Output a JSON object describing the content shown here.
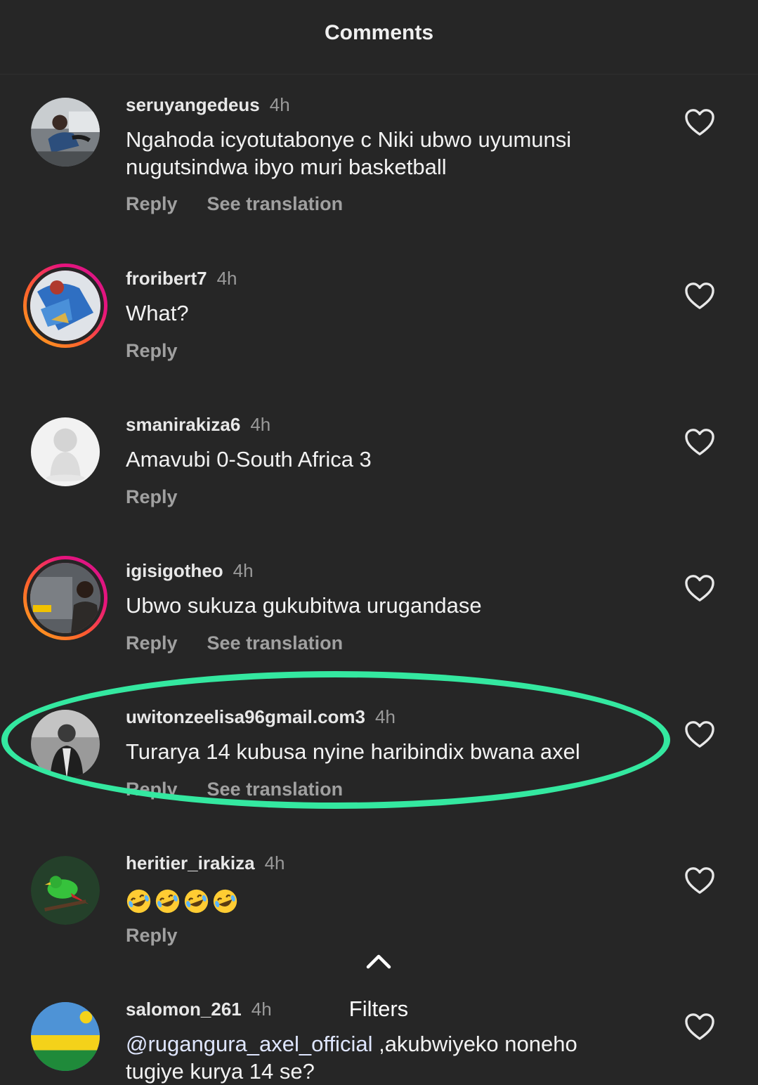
{
  "header": {
    "title": "Comments"
  },
  "comments": [
    {
      "username": "seruyangedeus",
      "time": "4h",
      "text": "Ngahoda icyotutabonye c Niki ubwo uyumunsi nugutsindwa ibyo muri basketball",
      "reply_label": "Reply",
      "translate_label": "See translation"
    },
    {
      "username": "froribert7",
      "time": "4h",
      "text": "What?",
      "reply_label": "Reply"
    },
    {
      "username": "smanirakiza6",
      "time": "4h",
      "text": "Amavubi 0-South Africa 3",
      "reply_label": "Reply"
    },
    {
      "username": "igisigotheo",
      "time": "4h",
      "text": "Ubwo sukuza gukubitwa urugandase",
      "reply_label": "Reply",
      "translate_label": "See translation"
    },
    {
      "username": "uwitonzeelisa96gmail.com3",
      "time": "4h",
      "text": "Turarya 14 kubusa nyine haribindix bwana axel",
      "reply_label": "Reply",
      "translate_label": "See translation"
    },
    {
      "username": "heritier_irakiza",
      "time": "4h",
      "emoji_count": 4,
      "emoji_name": "rolling-on-floor-laughing",
      "reply_label": "Reply"
    },
    {
      "username": "salomon_261",
      "time": "4h",
      "mention": "@rugangura_axel_official",
      "text": " ,akubwiyeko noneho",
      "text_line2": "tugiye kurya 14 se?"
    }
  ],
  "filters": {
    "label": "Filters",
    "icon": "chevron-up-icon"
  },
  "colors": {
    "background": "#262626",
    "highlight": "#34e8a0",
    "story_ring": [
      "#ff9a1f",
      "#e8147c"
    ]
  }
}
